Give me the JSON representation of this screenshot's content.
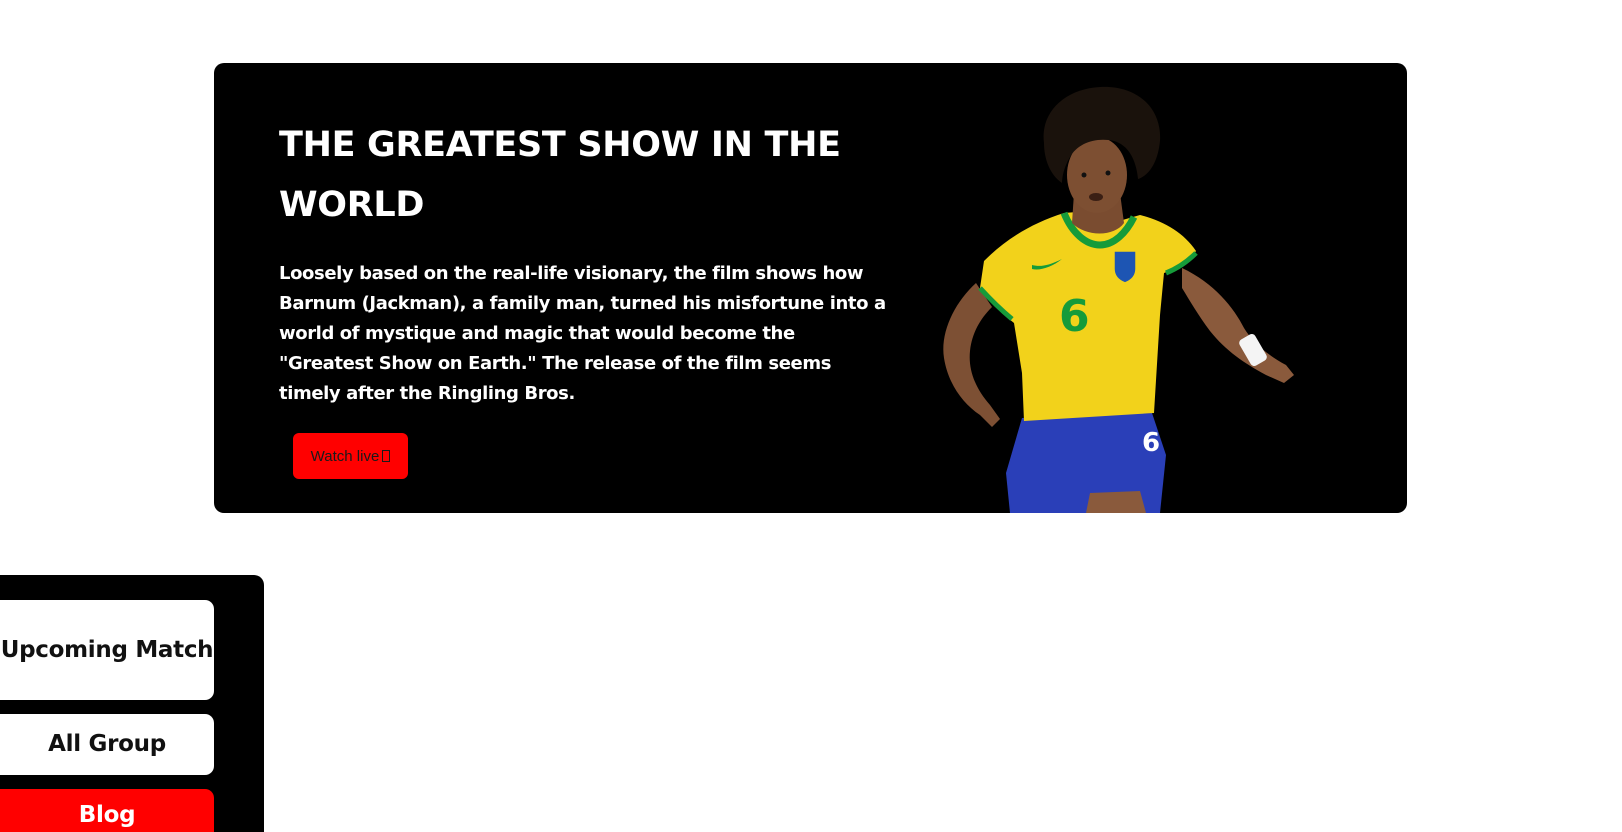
{
  "hero": {
    "title": "THE GREATEST SHOW IN THE WORLD",
    "description": "Loosely based on the real-life visionary, the film shows how Barnum (Jackman), a family man, turned his misfortune into a world of mystique and magic that would become the \"Greatest Show on Earth.\" The release of the film seems timely after the Ringling Bros.",
    "button_label": "Watch live",
    "button_icon": "missing-glyph-icon",
    "image_subject": "player-photo",
    "player_number": "6"
  },
  "sidebar": {
    "items": [
      {
        "label": "Upcoming Match",
        "active": false
      },
      {
        "label": "All Group",
        "active": false
      },
      {
        "label": "Blog",
        "active": true
      }
    ]
  },
  "colors": {
    "background": "#ffffff",
    "panel": "#000000",
    "accent": "#ff0000",
    "text_light": "#ffffff",
    "text_dark": "#111111",
    "jersey_yellow": "#f2d21b",
    "shorts_blue": "#2a3fb8",
    "jersey_green": "#169b3a"
  }
}
